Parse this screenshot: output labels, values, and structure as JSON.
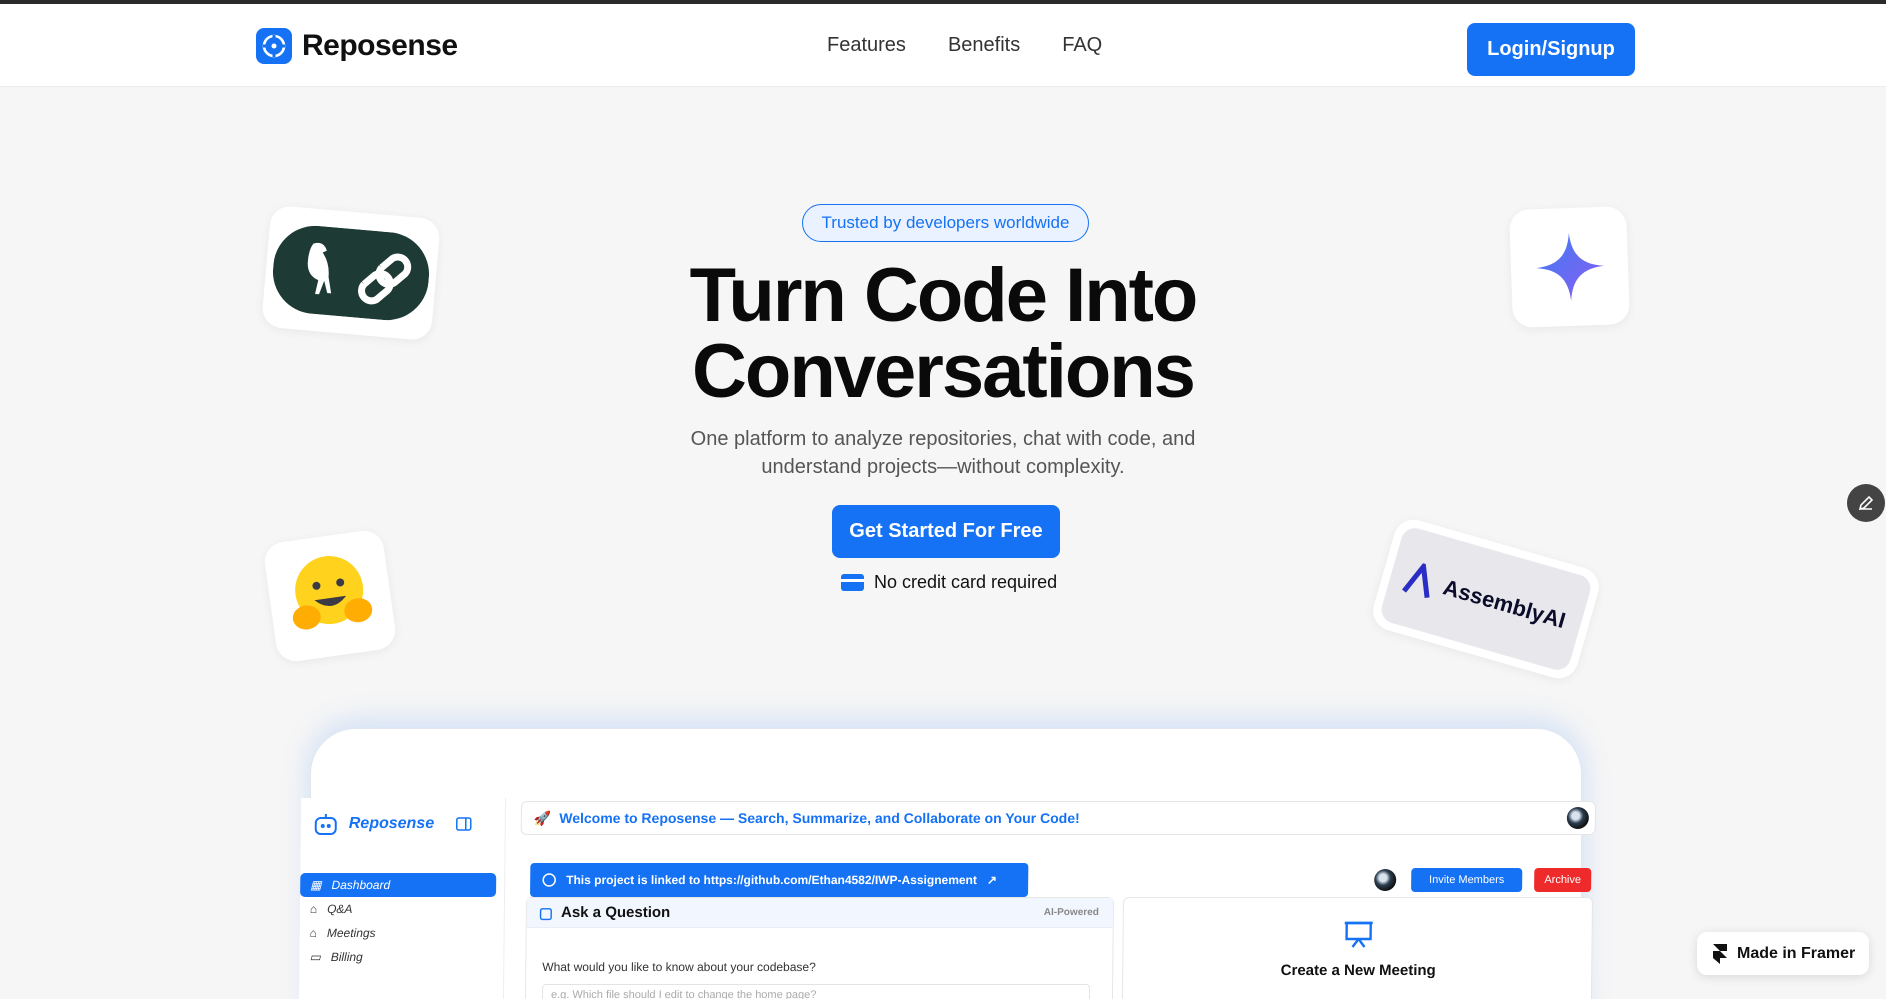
{
  "brand": {
    "name": "Reposense",
    "accent": "#1572f5"
  },
  "nav": {
    "links": [
      "Features",
      "Benefits",
      "FAQ"
    ],
    "login_label": "Login/Signup"
  },
  "hero": {
    "badge": "Trusted by developers worldwide",
    "title_line1": "Turn Code Into",
    "title_line2": "Conversations",
    "subtitle": "One platform to analyze repositories, chat with code, and understand projects—without complexity.",
    "cta_label": "Get Started For Free",
    "no_card": "No credit card required"
  },
  "floating_logos": {
    "langchain": "parrot-link-icon",
    "gemini": "sparkle-icon",
    "huggingface": "hugging-face-emoji",
    "assemblyai_text": "AssemblyAI"
  },
  "app_preview": {
    "sidebar": {
      "logo": "Reposense",
      "items": [
        "Dashboard",
        "Q&A",
        "Meetings",
        "Billing"
      ],
      "active": "Dashboard"
    },
    "welcome": "Welcome to Reposense — Search, Summarize, and Collaborate on Your Code!",
    "linked": "This project is linked to https://github.com/Ethan4582/IWP-Assignement",
    "invite_label": "Invite Members",
    "archive_label": "Archive",
    "ask": {
      "title": "Ask a Question",
      "tag": "AI-Powered",
      "question": "What would you like to know about your codebase?",
      "placeholder": "e.g. Which file should I edit to change the home page?"
    },
    "meeting": {
      "title": "Create a New Meeting"
    }
  },
  "framer_badge": "Made in Framer"
}
